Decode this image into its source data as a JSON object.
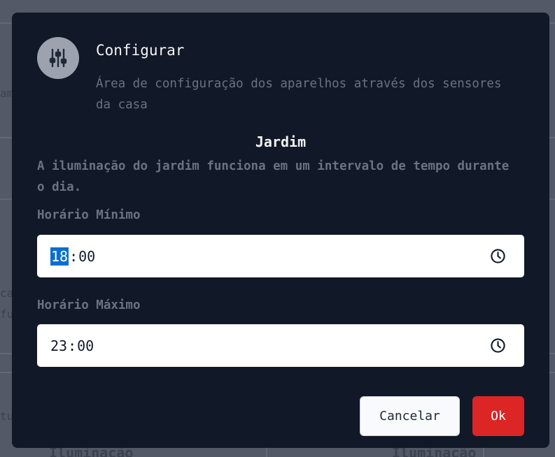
{
  "background": {
    "left_labels": [
      "am",
      "ca",
      "fu",
      "tu"
    ],
    "bottom_labels": [
      "Iluminação",
      "Iluminação"
    ]
  },
  "modal": {
    "icon": "sliders-icon",
    "title": "Configurar",
    "subtitle": "Área de configuração dos aparelhos através dos sensores da casa",
    "section": {
      "title": "Jardim",
      "description": "A iluminação do jardim funciona em um intervalo de tempo durante o dia."
    },
    "min_time": {
      "label": "Horário Mínimo",
      "hours": "18",
      "minutes": "00",
      "icon": "clock-icon"
    },
    "max_time": {
      "label": "Horário Máximo",
      "hours": "23",
      "minutes": "00",
      "icon": "clock-icon"
    },
    "buttons": {
      "cancel": "Cancelar",
      "ok": "Ok"
    },
    "colors": {
      "modal_bg": "#111827",
      "ok_button": "#dc2626",
      "selection": "#0a6ed1"
    }
  }
}
